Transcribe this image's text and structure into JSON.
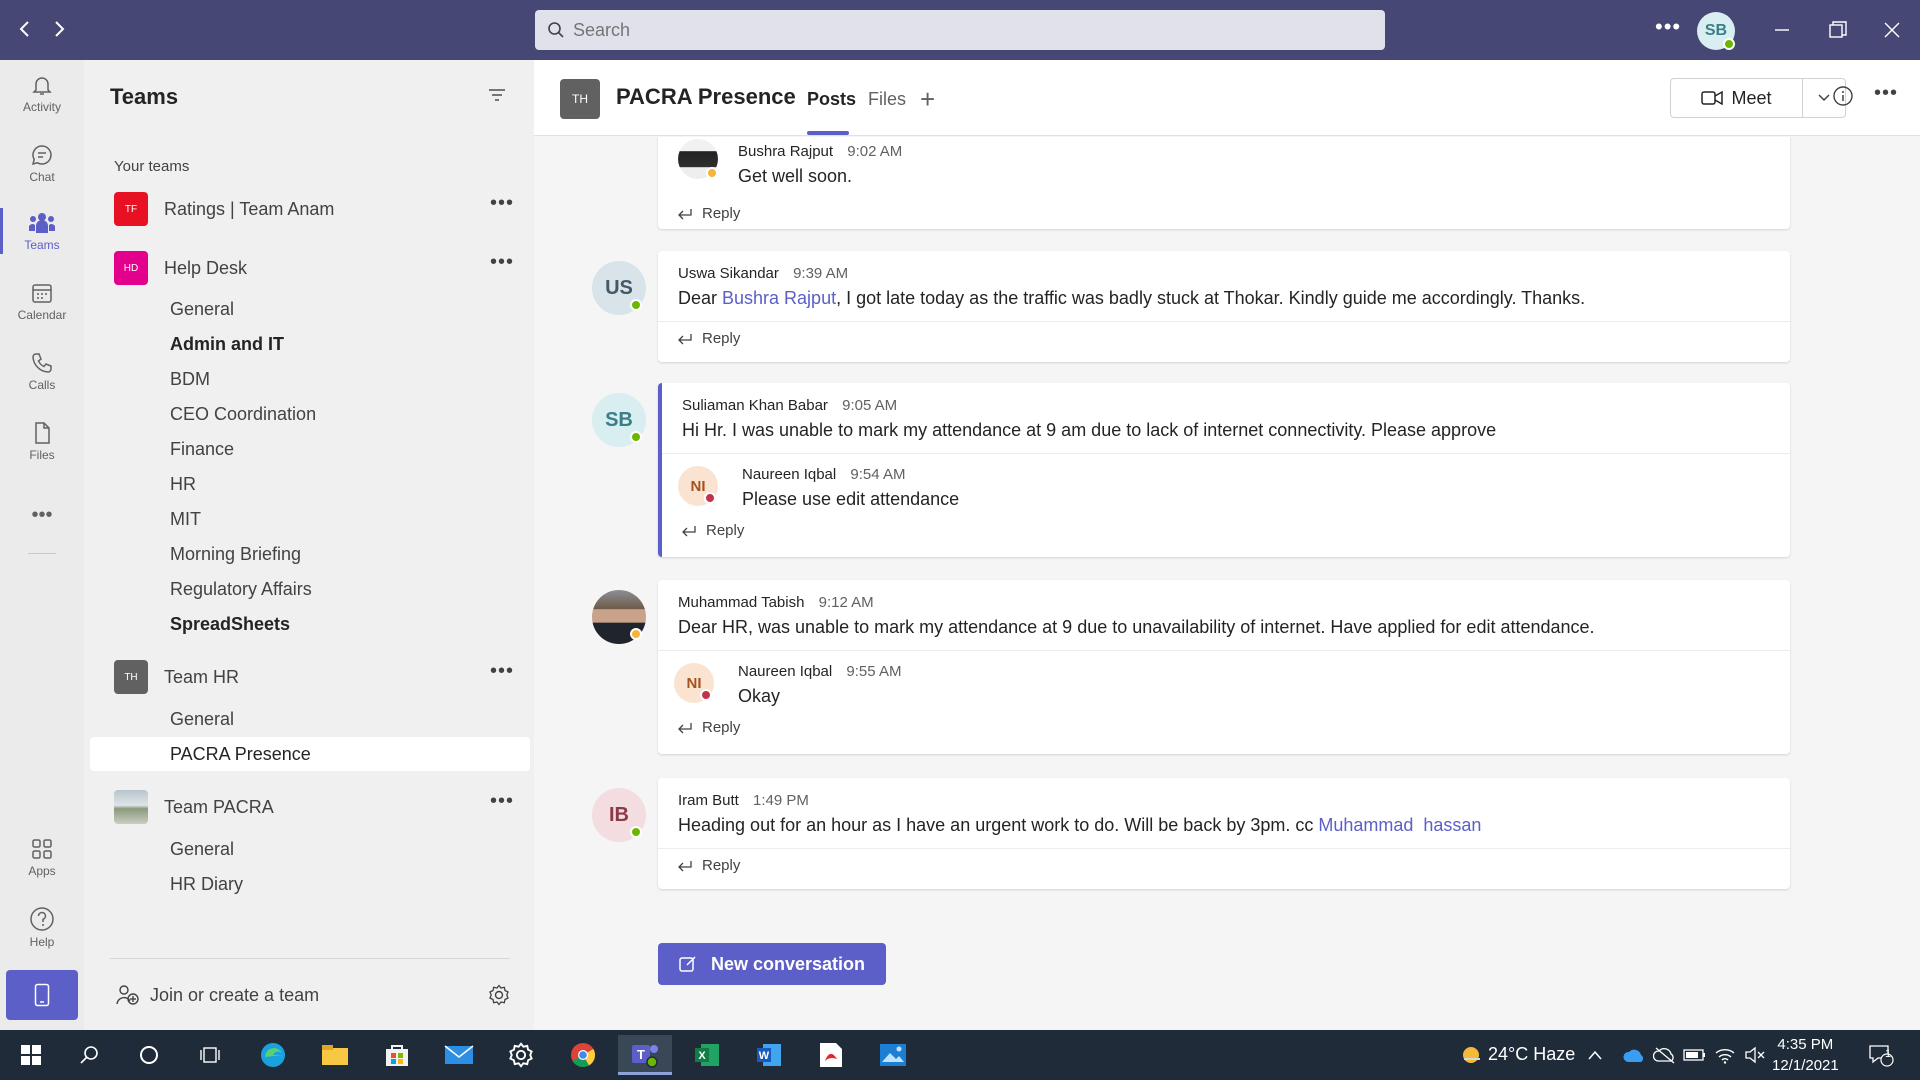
{
  "search": {
    "placeholder": "Search"
  },
  "titlebar": {
    "user_initials": "SB"
  },
  "rail": {
    "items": [
      {
        "label": "Activity",
        "icon": "bell-icon"
      },
      {
        "label": "Chat",
        "icon": "chat-icon"
      },
      {
        "label": "Teams",
        "icon": "teams-icon",
        "active": true
      },
      {
        "label": "Calendar",
        "icon": "calendar-icon"
      },
      {
        "label": "Calls",
        "icon": "phone-icon"
      },
      {
        "label": "Files",
        "icon": "file-icon"
      }
    ],
    "bottom": [
      {
        "label": "Apps",
        "icon": "apps-icon"
      },
      {
        "label": "Help",
        "icon": "help-icon"
      }
    ]
  },
  "panel": {
    "title": "Teams",
    "section_label": "Your teams",
    "teams": [
      {
        "initials": "TF",
        "name": "Ratings | Team Anam",
        "color": "#e81123",
        "channels": []
      },
      {
        "initials": "HD",
        "name": "Help Desk",
        "color": "#e3008c",
        "channels": [
          {
            "name": "General",
            "bold": false
          },
          {
            "name": "Admin and IT",
            "bold": true
          },
          {
            "name": "BDM",
            "bold": false
          },
          {
            "name": "CEO Coordination",
            "bold": false
          },
          {
            "name": "Finance",
            "bold": false
          },
          {
            "name": "HR",
            "bold": false
          },
          {
            "name": "MIT",
            "bold": false
          },
          {
            "name": "Morning Briefing",
            "bold": false
          },
          {
            "name": "Regulatory Affairs",
            "bold": false
          },
          {
            "name": "SpreadSheets",
            "bold": true
          }
        ]
      },
      {
        "initials": "TH",
        "name": "Team HR",
        "color": "#616161",
        "channels": [
          {
            "name": "General",
            "bold": false
          },
          {
            "name": "PACRA Presence",
            "bold": false,
            "selected": true
          }
        ]
      },
      {
        "initials": "",
        "name": "Team PACRA",
        "color": "#9aa7b1",
        "channels": [
          {
            "name": "General",
            "bold": false
          },
          {
            "name": "HR Diary",
            "bold": false
          }
        ]
      }
    ],
    "join_label": "Join or create a team"
  },
  "channel": {
    "team_initials": "TH",
    "title": "PACRA Presence",
    "tabs": [
      "Posts",
      "Files"
    ],
    "active_tab": "Posts",
    "meet_label": "Meet"
  },
  "posts": [
    {
      "partial": true,
      "replies": [
        {
          "author": "Bushra Rajput",
          "time": "9:02 AM",
          "body": "Get well soon.",
          "avatar": "photo-female",
          "presence": "yellow"
        }
      ],
      "reply_label": "Reply"
    },
    {
      "author": "Uswa Sikandar",
      "time": "9:39 AM",
      "initials": "US",
      "avatar_bg": "#d9e3ea",
      "avatar_fg": "#445866",
      "presence": "green",
      "body_pre": "Dear ",
      "mention": "Bushra Rajput",
      "body_post": ", I got late today as the traffic was badly stuck at Thokar. Kindly guide me accordingly. Thanks.",
      "replies": [],
      "reply_label": "Reply"
    },
    {
      "author": "Suliaman Khan Babar",
      "time": "9:05 AM",
      "initials": "SB",
      "avatar_bg": "#d9eef0",
      "avatar_fg": "#3a7f86",
      "presence": "green",
      "unread": true,
      "body": "Hi Hr. I was unable to mark my attendance at 9 am due to lack of internet connectivity. Please approve",
      "replies": [
        {
          "author": "Naureen Iqbal",
          "time": "9:54 AM",
          "body": "Please use edit attendance",
          "initials": "NI",
          "presence": "red"
        }
      ],
      "reply_label": "Reply"
    },
    {
      "author": "Muhammad Tabish",
      "time": "9:12 AM",
      "avatar": "photo-male",
      "presence": "yellow",
      "body": "Dear HR, was unable to mark my attendance at 9 due to unavailability of internet. Have applied for edit attendance.",
      "replies": [
        {
          "author": "Naureen Iqbal",
          "time": "9:55 AM",
          "body": "Okay",
          "initials": "NI",
          "presence": "red"
        }
      ],
      "reply_label": "Reply"
    },
    {
      "author": "Iram Butt",
      "time": "1:49 PM",
      "initials": "IB",
      "avatar_bg": "#f3dde0",
      "avatar_fg": "#8c3a48",
      "presence": "green",
      "body_pre": "Heading out for an hour as I have an urgent work to do. Will be back by 3pm. cc ",
      "mention": "Muhammad  hassan",
      "body_post": "",
      "replies": [],
      "reply_label": "Reply"
    }
  ],
  "new_conversation_label": "New conversation",
  "taskbar": {
    "weather": "24°C  Haze",
    "time": "4:35 PM",
    "date": "12/1/2021",
    "notification_count": "1"
  }
}
